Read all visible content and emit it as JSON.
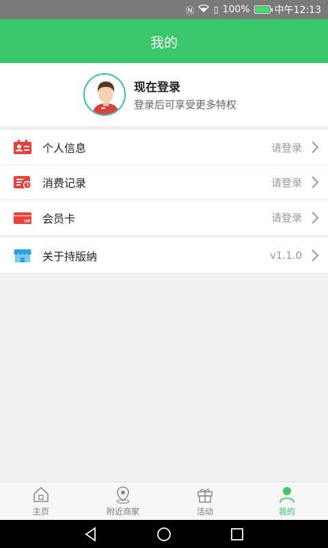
{
  "status_bar": {
    "battery": "100%",
    "time": "中午12:13",
    "battery_level": 1.0
  },
  "header": {
    "title": "我的"
  },
  "profile": {
    "title": "现在登录",
    "subtitle": "登录后可享受更多特权"
  },
  "menu": [
    {
      "label": "个人信息",
      "value": "请登录",
      "icon": "id-card-icon"
    },
    {
      "label": "消费记录",
      "value": "请登录",
      "icon": "receipt-icon"
    },
    {
      "label": "会员卡",
      "value": "请登录",
      "icon": "vip-card-icon"
    }
  ],
  "about": {
    "label": "关于持版纳",
    "value": "v1.1.0",
    "icon": "store-icon"
  },
  "tabs": [
    {
      "label": "主页",
      "icon": "home-icon"
    },
    {
      "label": "附近商家",
      "icon": "location-icon"
    },
    {
      "label": "活动",
      "icon": "gift-icon"
    },
    {
      "label": "我的",
      "icon": "user-icon",
      "active": true
    }
  ],
  "colors": {
    "primary": "#3cc76a",
    "icon_red": "#e8413b",
    "icon_blue": "#2aa1e0"
  }
}
